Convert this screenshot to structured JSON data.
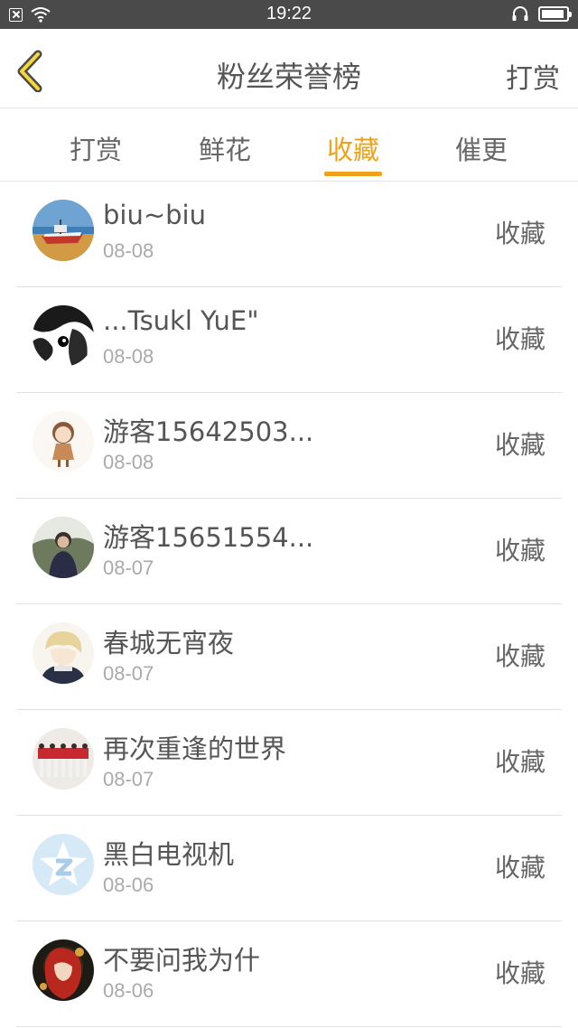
{
  "status_bar": {
    "time": "19:22",
    "icons": [
      "notification-x-icon",
      "wifi-icon",
      "headphones-icon",
      "battery-icon"
    ]
  },
  "header": {
    "title": "粉丝荣誉榜",
    "action_label": "打赏",
    "back_icon": "chevron-left-icon"
  },
  "colors": {
    "accent": "#f0a11a",
    "status_bar_bg": "#4a4a4a",
    "text": "#555555",
    "muted_text": "#aaaaaa",
    "divider": "#e2e2e2"
  },
  "tabs": [
    {
      "label": "打赏",
      "active": false
    },
    {
      "label": "鲜花",
      "active": false
    },
    {
      "label": "收藏",
      "active": true
    },
    {
      "label": "催更",
      "active": false
    }
  ],
  "fans": [
    {
      "name": "biu~biu",
      "date": "08-08",
      "action": "收藏",
      "avatar": "boat-on-beach"
    },
    {
      "name": "...Tsukl YuE\"",
      "date": "08-08",
      "action": "收藏",
      "avatar": "black-white-anime"
    },
    {
      "name": "游客15642503...",
      "date": "08-08",
      "action": "收藏",
      "avatar": "chibi-girl"
    },
    {
      "name": "游客15651554...",
      "date": "08-07",
      "action": "收藏",
      "avatar": "person-outdoors"
    },
    {
      "name": "春城无宵夜",
      "date": "08-07",
      "action": "收藏",
      "avatar": "blonde-anime-boy"
    },
    {
      "name": "再次重逢的世界",
      "date": "08-07",
      "action": "收藏",
      "avatar": "dancers-row"
    },
    {
      "name": "黑白电视机",
      "date": "08-06",
      "action": "收藏",
      "avatar": "default-star-z"
    },
    {
      "name": "不要问我为什",
      "date": "08-06",
      "action": "收藏",
      "avatar": "red-hair-anime"
    }
  ]
}
